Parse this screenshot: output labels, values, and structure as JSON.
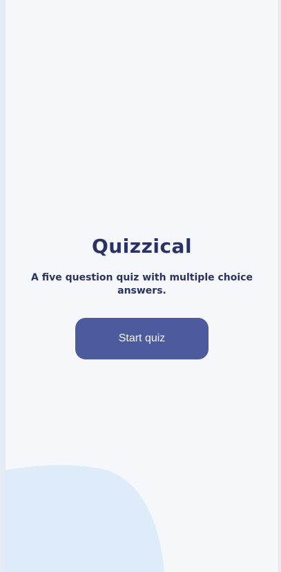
{
  "app": {
    "title": "Quizzical",
    "subtitle": "A five question quiz with multiple choice answers.",
    "start_button_label": "Start quiz"
  },
  "colors": {
    "background": "#f5f7fb",
    "text": "#293264",
    "button": "#4d5b9e",
    "button_text": "#f5f7fb",
    "blob": "#deebf8"
  }
}
